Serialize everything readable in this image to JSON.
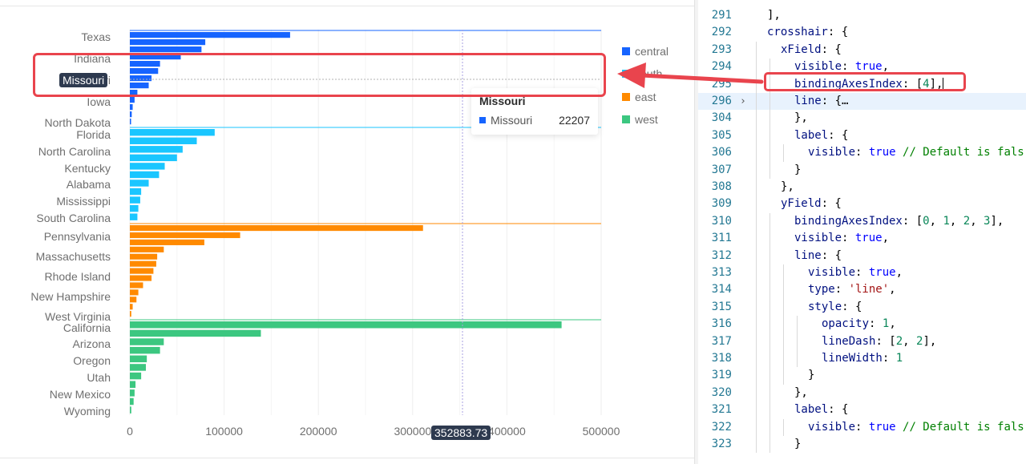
{
  "chart_data": {
    "type": "bar",
    "orientation": "horizontal",
    "groups": [
      {
        "region": "central",
        "color": "#1664ff",
        "labels": [
          "Texas",
          "Indiana",
          "Missouri",
          "Iowa",
          "North Dakota"
        ],
        "values": [
          170000,
          80000,
          76000,
          54000,
          32000,
          30000,
          23000,
          20000,
          8000,
          5000,
          3000,
          2000,
          1000
        ]
      },
      {
        "region": "south",
        "color": "#1ac6ff",
        "labels": [
          "Florida",
          "North Carolina",
          "Kentucky",
          "Alabama",
          "Mississippi",
          "South Carolina"
        ],
        "values": [
          90000,
          71000,
          56000,
          50000,
          37000,
          31000,
          20000,
          12000,
          11000,
          9000,
          8000
        ]
      },
      {
        "region": "east",
        "color": "#ff8a00",
        "labels": [
          "Pennsylvania",
          "Massachusetts",
          "Rhode Island",
          "New Hampshire",
          "West Virginia"
        ],
        "values": [
          311000,
          117000,
          79000,
          36000,
          29000,
          28000,
          25000,
          23000,
          14000,
          9000,
          7000,
          3000,
          1500
        ]
      },
      {
        "region": "west",
        "color": "#3cc780",
        "labels": [
          "California",
          "Arizona",
          "Oregon",
          "Utah",
          "New Mexico",
          "Wyoming"
        ],
        "values": [
          458000,
          139000,
          36000,
          32000,
          18000,
          17000,
          12000,
          6000,
          5000,
          4000,
          1500
        ]
      }
    ],
    "x_ticks": [
      "0",
      "100000",
      "200000",
      "300000",
      "400000",
      "500000"
    ],
    "xlim": [
      0,
      500000
    ],
    "grid": true,
    "legend": {
      "placement": "right",
      "items": [
        {
          "label": "central",
          "color": "#1664ff"
        },
        {
          "label": "south",
          "color": "#1ac6ff"
        },
        {
          "label": "east",
          "color": "#ff8a00"
        },
        {
          "label": "west",
          "color": "#3cc780"
        }
      ]
    }
  },
  "crosshair": {
    "y_label": "Missouri",
    "x_label": "352883.73",
    "x_value": 352883.73
  },
  "tooltip": {
    "title": "Missouri",
    "series_name": "Missouri",
    "value": "22207",
    "color": "#1664ff"
  },
  "annotation": {
    "color": "#e9444d"
  },
  "editor": {
    "active_line": "296",
    "lines": [
      {
        "n": "291",
        "indent": 0,
        "tokens": [
          [
            "p",
            "],"
          ]
        ]
      },
      {
        "n": "292",
        "indent": 0,
        "tokens": [
          [
            "k",
            "crosshair"
          ],
          [
            "p",
            ": {"
          ]
        ]
      },
      {
        "n": "293",
        "indent": 1,
        "tokens": [
          [
            "k",
            "xField"
          ],
          [
            "p",
            ": {"
          ]
        ]
      },
      {
        "n": "294",
        "indent": 2,
        "tokens": [
          [
            "k",
            "visible"
          ],
          [
            "p",
            ": "
          ],
          [
            "w",
            "true"
          ],
          [
            "p",
            ","
          ]
        ]
      },
      {
        "n": "295",
        "indent": 2,
        "tokens": [
          [
            "k",
            "bindingAxesIndex"
          ],
          [
            "p",
            ": ["
          ],
          [
            "n",
            "4"
          ],
          [
            "p",
            "],"
          ]
        ],
        "caret": true
      },
      {
        "n": "296",
        "indent": 2,
        "fold": "›",
        "tokens": [
          [
            "k",
            "line"
          ],
          [
            "p",
            ": {…"
          ]
        ]
      },
      {
        "n": "304",
        "indent": 2,
        "tokens": [
          [
            "p",
            "},"
          ]
        ]
      },
      {
        "n": "305",
        "indent": 2,
        "tokens": [
          [
            "k",
            "label"
          ],
          [
            "p",
            ": {"
          ]
        ]
      },
      {
        "n": "306",
        "indent": 3,
        "tokens": [
          [
            "k",
            "visible"
          ],
          [
            "p",
            ": "
          ],
          [
            "w",
            "true"
          ],
          [
            "c",
            " // Default is fals"
          ]
        ]
      },
      {
        "n": "307",
        "indent": 2,
        "tokens": [
          [
            "p",
            "}"
          ]
        ]
      },
      {
        "n": "308",
        "indent": 1,
        "tokens": [
          [
            "p",
            "},"
          ]
        ]
      },
      {
        "n": "309",
        "indent": 1,
        "tokens": [
          [
            "k",
            "yField"
          ],
          [
            "p",
            ": {"
          ]
        ]
      },
      {
        "n": "310",
        "indent": 2,
        "tokens": [
          [
            "k",
            "bindingAxesIndex"
          ],
          [
            "p",
            ": ["
          ],
          [
            "n",
            "0"
          ],
          [
            "p",
            ", "
          ],
          [
            "n",
            "1"
          ],
          [
            "p",
            ", "
          ],
          [
            "n",
            "2"
          ],
          [
            "p",
            ", "
          ],
          [
            "n",
            "3"
          ],
          [
            "p",
            "],"
          ]
        ]
      },
      {
        "n": "311",
        "indent": 2,
        "tokens": [
          [
            "k",
            "visible"
          ],
          [
            "p",
            ": "
          ],
          [
            "w",
            "true"
          ],
          [
            "p",
            ","
          ]
        ]
      },
      {
        "n": "312",
        "indent": 2,
        "tokens": [
          [
            "k",
            "line"
          ],
          [
            "p",
            ": {"
          ]
        ]
      },
      {
        "n": "313",
        "indent": 3,
        "tokens": [
          [
            "k",
            "visible"
          ],
          [
            "p",
            ": "
          ],
          [
            "w",
            "true"
          ],
          [
            "p",
            ","
          ]
        ]
      },
      {
        "n": "314",
        "indent": 3,
        "tokens": [
          [
            "k",
            "type"
          ],
          [
            "p",
            ": "
          ],
          [
            "s",
            "'line'"
          ],
          [
            "p",
            ","
          ]
        ]
      },
      {
        "n": "315",
        "indent": 3,
        "tokens": [
          [
            "k",
            "style"
          ],
          [
            "p",
            ": {"
          ]
        ]
      },
      {
        "n": "316",
        "indent": 4,
        "tokens": [
          [
            "k",
            "opacity"
          ],
          [
            "p",
            ": "
          ],
          [
            "n",
            "1"
          ],
          [
            "p",
            ","
          ]
        ]
      },
      {
        "n": "317",
        "indent": 4,
        "tokens": [
          [
            "k",
            "lineDash"
          ],
          [
            "p",
            ": ["
          ],
          [
            "n",
            "2"
          ],
          [
            "p",
            ", "
          ],
          [
            "n",
            "2"
          ],
          [
            "p",
            "],"
          ]
        ]
      },
      {
        "n": "318",
        "indent": 4,
        "tokens": [
          [
            "k",
            "lineWidth"
          ],
          [
            "p",
            ": "
          ],
          [
            "n",
            "1"
          ]
        ]
      },
      {
        "n": "319",
        "indent": 3,
        "tokens": [
          [
            "p",
            "}"
          ]
        ]
      },
      {
        "n": "320",
        "indent": 2,
        "tokens": [
          [
            "p",
            "},"
          ]
        ]
      },
      {
        "n": "321",
        "indent": 2,
        "tokens": [
          [
            "k",
            "label"
          ],
          [
            "p",
            ": {"
          ]
        ]
      },
      {
        "n": "322",
        "indent": 3,
        "tokens": [
          [
            "k",
            "visible"
          ],
          [
            "p",
            ": "
          ],
          [
            "w",
            "true"
          ],
          [
            "c",
            " // Default is fals"
          ]
        ]
      },
      {
        "n": "323",
        "indent": 2,
        "tokens": [
          [
            "p",
            "}"
          ]
        ]
      }
    ]
  }
}
